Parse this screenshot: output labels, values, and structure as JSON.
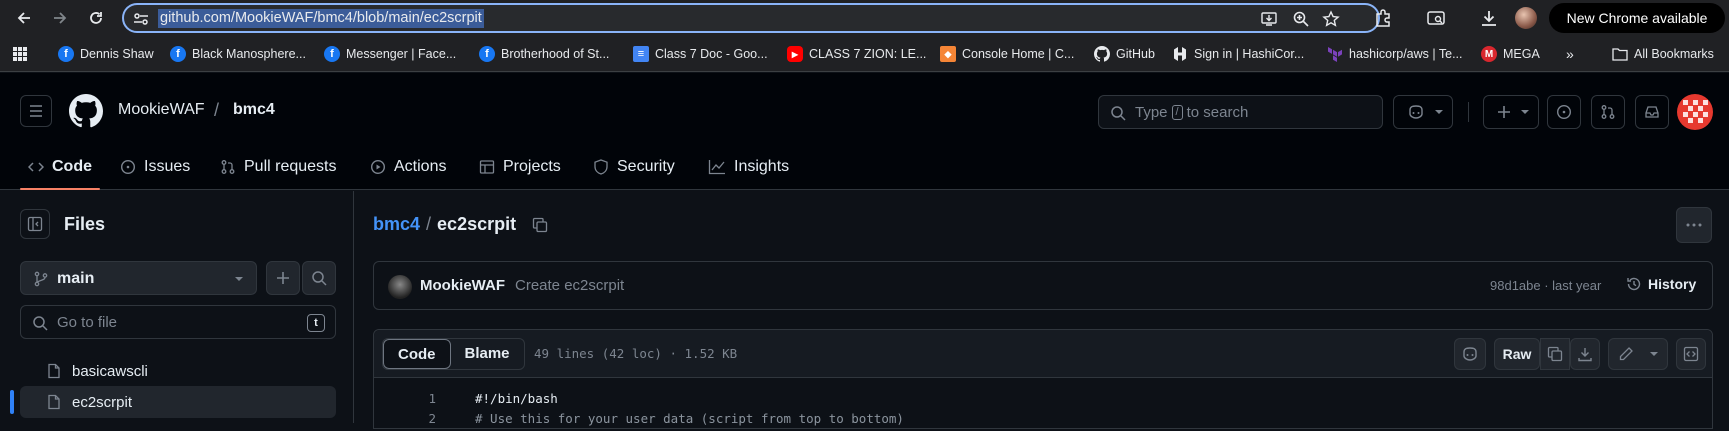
{
  "browser": {
    "url": "github.com/MookieWAF/bmc4/blob/main/ec2scrpit",
    "new_chrome_label": "New Chrome available",
    "bookmarks": [
      {
        "label": "Dennis Shaw",
        "icon": "facebook-icon"
      },
      {
        "label": "Black Manosphere...",
        "icon": "facebook-icon"
      },
      {
        "label": "Messenger | Face...",
        "icon": "facebook-icon"
      },
      {
        "label": "Brotherhood of St...",
        "icon": "facebook-icon"
      },
      {
        "label": "Class 7 Doc - Goo...",
        "icon": "google-docs-icon"
      },
      {
        "label": "CLASS 7 ZION: LE...",
        "icon": "youtube-icon"
      },
      {
        "label": "Console Home | C...",
        "icon": "aws-console-icon"
      },
      {
        "label": "GitHub",
        "icon": "github-icon"
      },
      {
        "label": "Sign in | HashiCor...",
        "icon": "hashicorp-icon"
      },
      {
        "label": "hashicorp/aws | Te...",
        "icon": "terraform-icon"
      },
      {
        "label": "MEGA",
        "icon": "mega-icon"
      }
    ],
    "all_bookmarks_label": "All Bookmarks"
  },
  "header": {
    "owner": "MookieWAF",
    "repo": "bmc4",
    "search_prefix": "Type",
    "search_kbd": "/",
    "search_suffix": "to search"
  },
  "tabs": [
    {
      "label": "Code",
      "icon": "code-icon"
    },
    {
      "label": "Issues",
      "icon": "issue-icon"
    },
    {
      "label": "Pull requests",
      "icon": "pull-request-icon"
    },
    {
      "label": "Actions",
      "icon": "play-icon"
    },
    {
      "label": "Projects",
      "icon": "table-icon"
    },
    {
      "label": "Security",
      "icon": "shield-icon"
    },
    {
      "label": "Insights",
      "icon": "graph-icon"
    }
  ],
  "sidebar": {
    "title": "Files",
    "branch": "main",
    "goto_placeholder": "Go to file",
    "goto_kbd": "t",
    "files": [
      "basicawscli",
      "ec2scrpit"
    ]
  },
  "main": {
    "crumb_repo": "bmc4",
    "crumb_sep": "/",
    "crumb_file": "ec2scrpit",
    "commit": {
      "author": "MookieWAF",
      "message": "Create ec2scrpit",
      "meta": "98d1abe · last year",
      "history_label": "History"
    },
    "file": {
      "code_tab": "Code",
      "blame_tab": "Blame",
      "info": "49 lines (42 loc) · 1.52 KB",
      "raw_label": "Raw",
      "lines": [
        {
          "n": "1",
          "text": "#!/bin/bash"
        },
        {
          "n": "2",
          "text": "# Use this for your user data (script from top to bottom)"
        }
      ]
    }
  }
}
